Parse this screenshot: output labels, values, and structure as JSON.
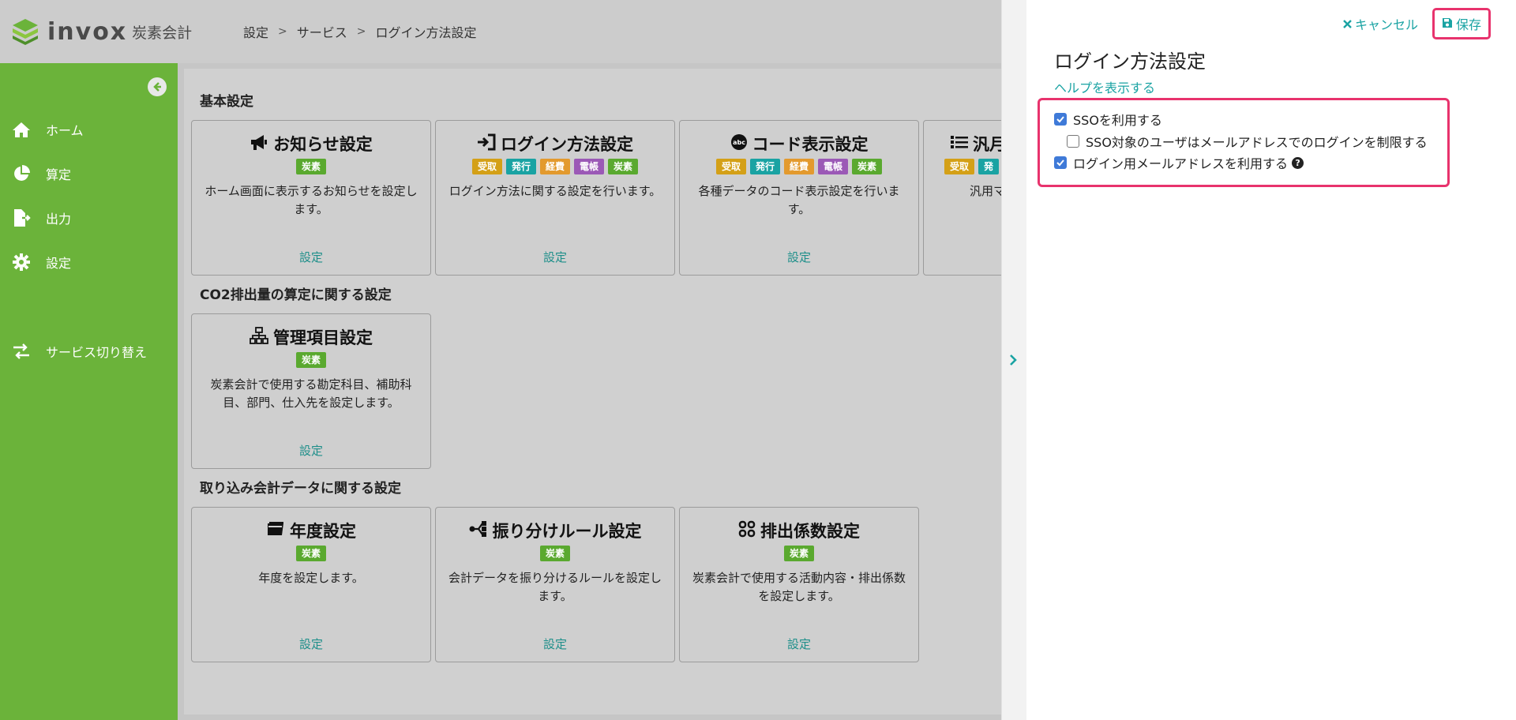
{
  "header": {
    "logo_text": "invox",
    "logo_sub": "炭素会計",
    "breadcrumb": [
      "設定",
      "サービス",
      "ログイン方法設定"
    ]
  },
  "sidebar": {
    "items": [
      {
        "label": "ホーム",
        "icon": "home-icon"
      },
      {
        "label": "算定",
        "icon": "pie-chart-icon"
      },
      {
        "label": "出力",
        "icon": "file-export-icon"
      },
      {
        "label": "設定",
        "icon": "gear-icon"
      },
      {
        "label": "サービス切り替え",
        "icon": "switch-icon"
      }
    ]
  },
  "sections": {
    "basic": "基本設定",
    "co2": "CO2排出量の算定に関する設定",
    "import": "取り込み会計データに関する設定"
  },
  "tag_colors": {
    "受取": "#d4a017",
    "発行": "#1aa3a3",
    "経費": "#e39a2e",
    "電帳": "#9b59b6",
    "炭素": "#5aa92f"
  },
  "cards": [
    {
      "title": "お知らせ設定",
      "icon": "megaphone-icon",
      "tags": [
        "炭素"
      ],
      "desc": "ホーム画面に表示するお知らせを設定します。",
      "link": "設定"
    },
    {
      "title": "ログイン方法設定",
      "icon": "sign-in-icon",
      "tags": [
        "受取",
        "発行",
        "経費",
        "電帳",
        "炭素"
      ],
      "desc": "ログイン方法に関する設定を行います。",
      "link": "設定"
    },
    {
      "title": "コード表示設定",
      "icon": "abc-icon",
      "tags": [
        "受取",
        "発行",
        "経費",
        "電帳",
        "炭素"
      ],
      "desc": "各種データのコード表示設定を行います。",
      "link": "設定"
    },
    {
      "title": "汎月",
      "icon": "list-icon",
      "tags": [
        "受取",
        "発"
      ],
      "desc": "汎用マ",
      "link": ""
    },
    {
      "title": "管理項目設定",
      "icon": "sitemap-icon",
      "tags": [
        "炭素"
      ],
      "desc": "炭素会計で使用する勘定科目、補助科目、部門、仕入先を設定します。",
      "link": "設定"
    },
    {
      "title": "年度設定",
      "icon": "calendar-icon",
      "tags": [
        "炭素"
      ],
      "desc": "年度を設定します。",
      "link": "設定"
    },
    {
      "title": "振り分けルール設定",
      "icon": "branch-icon",
      "tags": [
        "炭素"
      ],
      "desc": "会計データを振り分けるルールを設定します。",
      "link": "設定"
    },
    {
      "title": "排出係数設定",
      "icon": "grid-icon",
      "tags": [
        "炭素"
      ],
      "desc": "炭素会計で使用する活動内容・排出係数を設定します。",
      "link": "設定"
    }
  ],
  "drawer": {
    "cancel_label": "キャンセル",
    "save_label": "保存",
    "title": "ログイン方法設定",
    "help_link": "ヘルプを表示する",
    "options": [
      {
        "label": "SSOを利用する",
        "checked": true
      },
      {
        "label": "SSO対象のユーザはメールアドレスでのログインを制限する",
        "checked": false
      },
      {
        "label": "ログイン用メールアドレスを利用する",
        "checked": true
      }
    ]
  }
}
